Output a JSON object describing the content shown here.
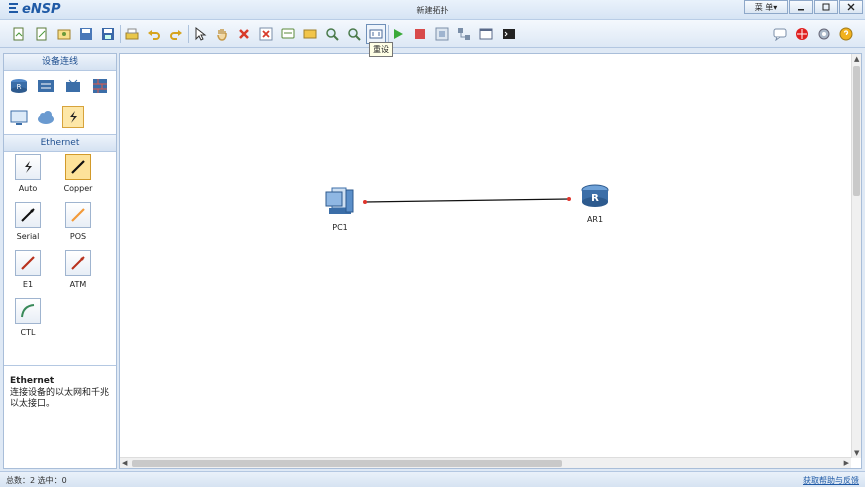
{
  "app": {
    "logo_text": "eNSP",
    "window_title": "新建拓扑",
    "menu_label": "菜 单▾"
  },
  "toolbar": {
    "tooltip": "重设"
  },
  "left_panel": {
    "device_section_title": "设备连线",
    "cable_section_title": "Ethernet",
    "cables": [
      {
        "label": "Auto"
      },
      {
        "label": "Copper"
      },
      {
        "label": "Serial"
      },
      {
        "label": "POS"
      },
      {
        "label": "E1"
      },
      {
        "label": "ATM"
      },
      {
        "label": "CTL"
      }
    ],
    "description": {
      "title": "Ethernet",
      "text": "连接设备的以太网和千兆以太接口。"
    }
  },
  "canvas": {
    "nodes": [
      {
        "label": "PC1",
        "type": "pc"
      },
      {
        "label": "AR1",
        "type": "router"
      }
    ]
  },
  "status": {
    "left": "总数：2  选中：0",
    "right": "获取帮助与反馈"
  },
  "colors": {
    "accent": "#1f5aa6",
    "link_endpoint": "#e0342c",
    "selected_fill": "#fde29a"
  }
}
